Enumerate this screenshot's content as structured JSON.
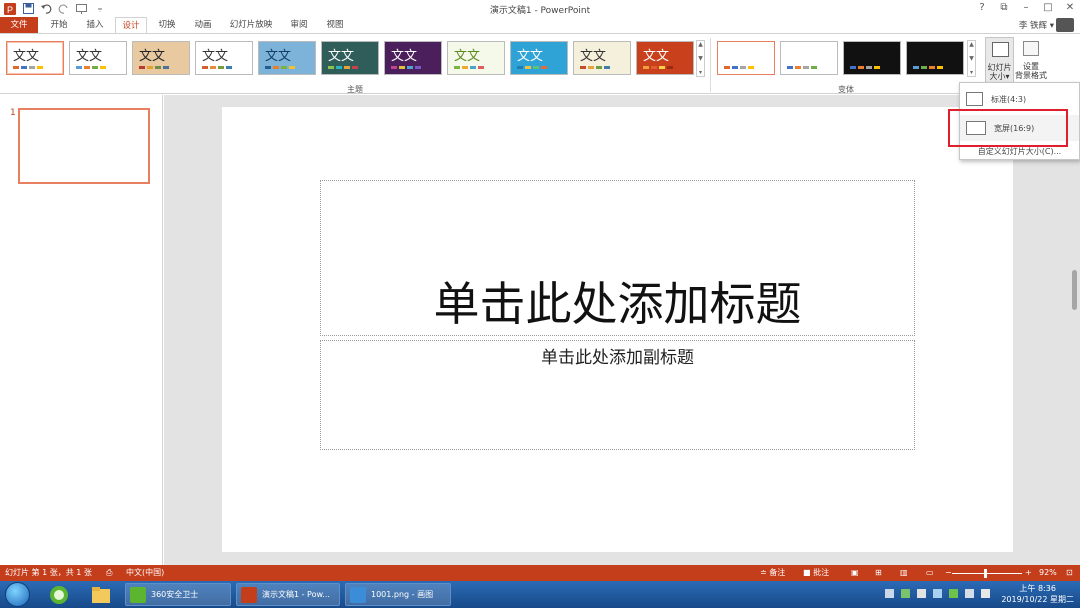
{
  "window": {
    "title": "演示文稿1 - PowerPoint",
    "controls": [
      "?",
      "⧉",
      "–",
      "□",
      "✕"
    ],
    "user": "李 铁辉 ▾"
  },
  "tabs": [
    {
      "label": "文件",
      "type": "file"
    },
    {
      "label": "开始"
    },
    {
      "label": "插入"
    },
    {
      "label": "设计",
      "active": true
    },
    {
      "label": "切换"
    },
    {
      "label": "动画"
    },
    {
      "label": "幻灯片放映"
    },
    {
      "label": "审阅"
    },
    {
      "label": "视图"
    }
  ],
  "ribbon": {
    "themes_label": "主题",
    "variants_label": "变体",
    "theme_text": "文文",
    "size_button": "幻灯片\n大小▾",
    "size_button_l1": "幻灯片",
    "size_button_l2": "大小▾",
    "bg_button_l1": "设置",
    "bg_button_l2": "背景格式"
  },
  "themes": [
    {
      "bg": "#ffffff",
      "fg": "#333333",
      "bars": [
        "#e06a2c",
        "#4472c4",
        "#a5a5a5",
        "#ffc000"
      ]
    },
    {
      "bg": "#ffffff",
      "fg": "#333333",
      "bars": [
        "#5b9bd5",
        "#ed7d31",
        "#70ad47",
        "#ffc000"
      ]
    },
    {
      "bg": "#e8c9a0",
      "fg": "#222222",
      "bars": [
        "#b33c2e",
        "#e3a02f",
        "#6e8c4c",
        "#4f6f96"
      ]
    },
    {
      "bg": "#ffffff",
      "fg": "#333333",
      "bars": [
        "#d35d2b",
        "#e88c3a",
        "#7a9c3b",
        "#3b7fb0"
      ]
    },
    {
      "bg": "#7db3d9",
      "fg": "#143d66",
      "bars": [
        "#1f5f94",
        "#e97d2b",
        "#7bb245",
        "#f2c230"
      ]
    },
    {
      "bg": "#2f5d5a",
      "fg": "#ffffff",
      "bars": [
        "#8ec24a",
        "#2bb3c0",
        "#e4a23a",
        "#c7424f"
      ]
    },
    {
      "bg": "#4a1f5b",
      "fg": "#ffffff",
      "bars": [
        "#c0448f",
        "#e0c23a",
        "#4fa3d1",
        "#7a5bc4"
      ]
    },
    {
      "bg": "#f4f9ea",
      "fg": "#5a8a1e",
      "bars": [
        "#7cb342",
        "#f0a830",
        "#4ba3c8",
        "#e05d5d"
      ]
    },
    {
      "bg": "#2fa3d6",
      "fg": "#ffffff",
      "bars": [
        "#1b7fb8",
        "#f0c040",
        "#5cc27a",
        "#e76a3a"
      ]
    },
    {
      "bg": "#f4f0dc",
      "fg": "#333333",
      "bars": [
        "#c64b2b",
        "#e8a33c",
        "#6f9e4a",
        "#3f7ea8"
      ]
    },
    {
      "bg": "#c9401c",
      "fg": "#ffffff",
      "bars": [
        "#f0a23a",
        "#e35b30",
        "#f7d04a",
        "#9c2a12"
      ]
    }
  ],
  "variants": [
    {
      "bg": "#ffffff",
      "bars": [
        "#e06a2c",
        "#4472c4",
        "#a5a5a5",
        "#ffc000"
      ]
    },
    {
      "bg": "#ffffff",
      "bars": [
        "#4472c4",
        "#ed7d31",
        "#a5a5a5",
        "#70ad47"
      ]
    },
    {
      "bg": "#111111",
      "bars": [
        "#4472c4",
        "#ed7d31",
        "#a5a5a5",
        "#ffc000"
      ]
    },
    {
      "bg": "#111111",
      "bars": [
        "#5b9bd5",
        "#70ad47",
        "#ed7d31",
        "#ffc000"
      ]
    }
  ],
  "dropdown": {
    "standard": "标准(4:3)",
    "widescreen": "宽屏(16:9)",
    "custom": "自定义幻灯片大小(C)..."
  },
  "slide_pane": {
    "number": "1"
  },
  "slide": {
    "title_placeholder": "单击此处添加标题",
    "subtitle_placeholder": "单击此处添加副标题"
  },
  "statusbar": {
    "slide_info": "幻灯片 第 1 张，共 1 张",
    "language": "中文(中国)",
    "notes": "≐ 备注",
    "comments": "■ 批注",
    "zoom_minus": "−",
    "zoom_plus": "+",
    "zoom": "92%"
  },
  "taskbar": {
    "tasks": [
      {
        "label": "360安全卫士",
        "color": "#5cb531"
      },
      {
        "label": "演示文稿1 - Pow...",
        "color": "#c43e1c"
      },
      {
        "label": "1001.png - 画图",
        "color": "#3c8dd8"
      }
    ],
    "time": "上午 8:36",
    "date": "2019/10/22 星期二"
  },
  "colors": {
    "accent": "#c43e1c",
    "highlight_box": "#e01f2e",
    "thumb_border": "#e8805f"
  }
}
